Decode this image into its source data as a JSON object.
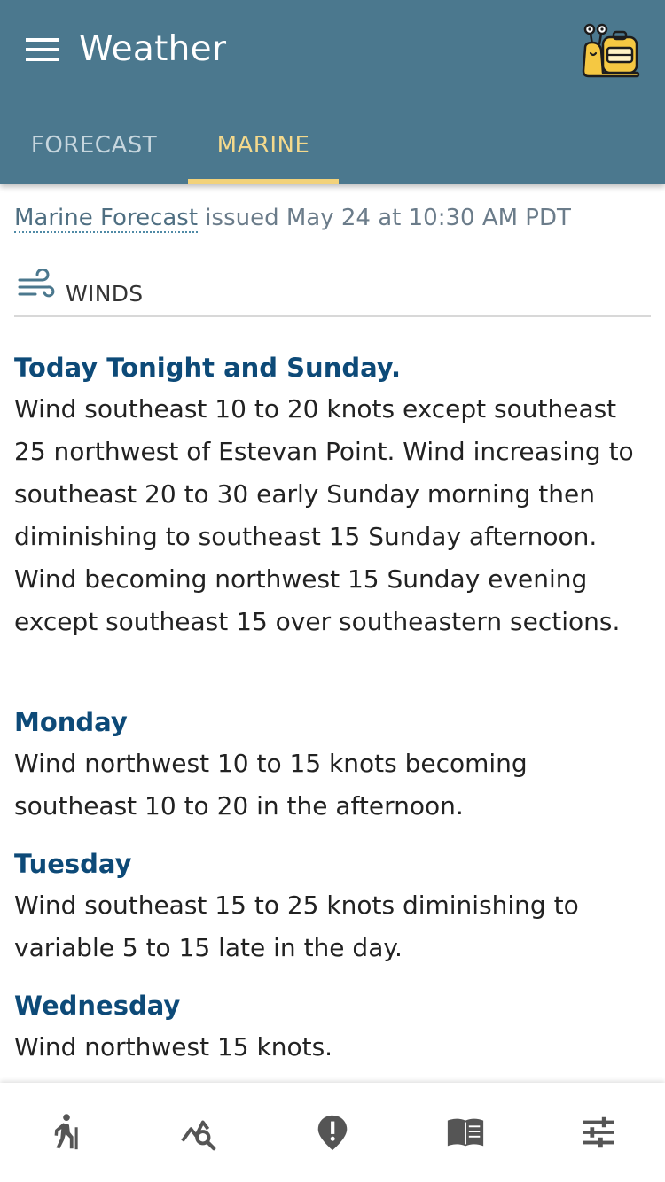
{
  "header": {
    "title": "Weather",
    "tabs": [
      {
        "label": "FORECAST",
        "active": false
      },
      {
        "label": "MARINE",
        "active": true
      }
    ]
  },
  "issued": {
    "link_text": "Marine Forecast",
    "text": " issued May 24 at 10:30 AM PDT"
  },
  "section": {
    "title": "WINDS",
    "icon": "wind-icon"
  },
  "forecasts": [
    {
      "period": "Today Tonight and Sunday.",
      "text": "Wind southeast 10 to 20 knots except southeast 25 northwest of Estevan Point. Wind increasing to southeast 20 to 30 early Sunday morning then diminishing to southeast 15 Sunday afternoon. Wind becoming northwest 15 Sunday evening except southeast 15 over southeastern sections."
    },
    {
      "period": "Monday",
      "text": "Wind northwest 10 to 15 knots becoming southeast 10 to 20 in the afternoon."
    },
    {
      "period": "Tuesday",
      "text": "Wind southeast 15 to 25 knots diminishing to variable 5 to 15 late in the day."
    },
    {
      "period": "Wednesday",
      "text": "Wind northwest 15 knots."
    }
  ],
  "bottom_nav": [
    {
      "icon": "hiker-icon"
    },
    {
      "icon": "chart-search-icon"
    },
    {
      "icon": "alert-icon"
    },
    {
      "icon": "book-icon"
    },
    {
      "icon": "sliders-icon"
    }
  ],
  "colors": {
    "app_bar": "#4b788e",
    "tab_active": "#f4d98c",
    "heading": "#0d4a78",
    "mascot": "#f5c842"
  }
}
